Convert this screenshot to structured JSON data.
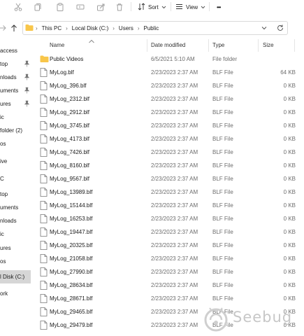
{
  "toolbar": {
    "sort_label": "Sort",
    "view_label": "View",
    "more_label": "•••",
    "icons": [
      "cut-icon",
      "copy-icon",
      "paste-icon",
      "rename-icon",
      "share-icon",
      "delete-icon",
      "sort-icon",
      "view-icon",
      "more-icon"
    ]
  },
  "address": {
    "crumbs": [
      "This PC",
      "Local Disk (C:)",
      "Users",
      "Public"
    ]
  },
  "nav": {
    "items": [
      {
        "label": "access",
        "pinned": false
      },
      {
        "label": "top",
        "pinned": true
      },
      {
        "label": "nloads",
        "pinned": true
      },
      {
        "label": "uments",
        "pinned": true
      },
      {
        "label": "ures",
        "pinned": true
      },
      {
        "label": "ic",
        "pinned": false
      },
      {
        "label": "folder (2)",
        "pinned": false
      },
      {
        "label": "os",
        "pinned": false
      },
      {
        "label": "ive",
        "pinned": false
      },
      {
        "label": "C",
        "pinned": false
      },
      {
        "label": "top",
        "pinned": false
      },
      {
        "label": "uments",
        "pinned": false
      },
      {
        "label": "nloads",
        "pinned": false
      },
      {
        "label": "ic",
        "pinned": false
      },
      {
        "label": "ures",
        "pinned": false
      },
      {
        "label": "os",
        "pinned": false
      },
      {
        "label": "l Disk (C:)",
        "pinned": false,
        "selected": true
      },
      {
        "label": "ork",
        "pinned": false
      }
    ]
  },
  "columns": {
    "name": "Name",
    "date": "Date modified",
    "type": "Type",
    "size": "Size"
  },
  "files": [
    {
      "name": "Public Videos",
      "date": "6/5/2021 5:10 AM",
      "type": "File folder",
      "size": "",
      "kind": "folder"
    },
    {
      "name": "MyLog.blf",
      "date": "2/23/2023 2:37 AM",
      "type": "BLF File",
      "size": "64 KB",
      "kind": "file"
    },
    {
      "name": "MyLog_396.blf",
      "date": "2/23/2023 2:37 AM",
      "type": "BLF File",
      "size": "0 KB",
      "kind": "file"
    },
    {
      "name": "MyLog_2312.blf",
      "date": "2/23/2023 2:37 AM",
      "type": "BLF File",
      "size": "0 KB",
      "kind": "file"
    },
    {
      "name": "MyLog_2912.blf",
      "date": "2/23/2023 2:37 AM",
      "type": "BLF File",
      "size": "0 KB",
      "kind": "file"
    },
    {
      "name": "MyLog_3745.blf",
      "date": "2/23/2023 2:37 AM",
      "type": "BLF File",
      "size": "0 KB",
      "kind": "file"
    },
    {
      "name": "MyLog_4173.blf",
      "date": "2/23/2023 2:37 AM",
      "type": "BLF File",
      "size": "0 KB",
      "kind": "file"
    },
    {
      "name": "MyLog_7426.blf",
      "date": "2/23/2023 2:37 AM",
      "type": "BLF File",
      "size": "0 KB",
      "kind": "file"
    },
    {
      "name": "MyLog_8160.blf",
      "date": "2/23/2023 2:37 AM",
      "type": "BLF File",
      "size": "0 KB",
      "kind": "file"
    },
    {
      "name": "MyLog_9567.blf",
      "date": "2/23/2023 2:37 AM",
      "type": "BLF File",
      "size": "0 KB",
      "kind": "file"
    },
    {
      "name": "MyLog_13989.blf",
      "date": "2/23/2023 2:37 AM",
      "type": "BLF File",
      "size": "0 KB",
      "kind": "file"
    },
    {
      "name": "MyLog_15144.blf",
      "date": "2/23/2023 2:37 AM",
      "type": "BLF File",
      "size": "0 KB",
      "kind": "file"
    },
    {
      "name": "MyLog_16253.blf",
      "date": "2/23/2023 2:37 AM",
      "type": "BLF File",
      "size": "0 KB",
      "kind": "file"
    },
    {
      "name": "MyLog_19447.blf",
      "date": "2/23/2023 2:37 AM",
      "type": "BLF File",
      "size": "0 KB",
      "kind": "file"
    },
    {
      "name": "MyLog_20325.blf",
      "date": "2/23/2023 2:37 AM",
      "type": "BLF File",
      "size": "0 KB",
      "kind": "file"
    },
    {
      "name": "MyLog_21058.blf",
      "date": "2/23/2023 2:37 AM",
      "type": "BLF File",
      "size": "0 KB",
      "kind": "file"
    },
    {
      "name": "MyLog_27990.blf",
      "date": "2/23/2023 2:37 AM",
      "type": "BLF File",
      "size": "0 KB",
      "kind": "file"
    },
    {
      "name": "MyLog_28634.blf",
      "date": "2/23/2023 2:37 AM",
      "type": "BLF File",
      "size": "0 KB",
      "kind": "file"
    },
    {
      "name": "MyLog_28671.blf",
      "date": "2/23/2023 2:37 AM",
      "type": "BLF File",
      "size": "0 KB",
      "kind": "file"
    },
    {
      "name": "MyLog_29465.blf",
      "date": "2/23/2023 2:37 AM",
      "type": "BLF File",
      "size": "0 KB",
      "kind": "file"
    },
    {
      "name": "MyLog_29479.blf",
      "date": "2/23/2023 2:37 AM",
      "type": "BLF File",
      "size": "0 KB",
      "kind": "file"
    }
  ],
  "watermark": {
    "text": "Seebug"
  },
  "colors": {
    "folder": "#f8c64a",
    "selected_nav": "#d6d6d6",
    "secondary_text": "#6d6d6d"
  }
}
